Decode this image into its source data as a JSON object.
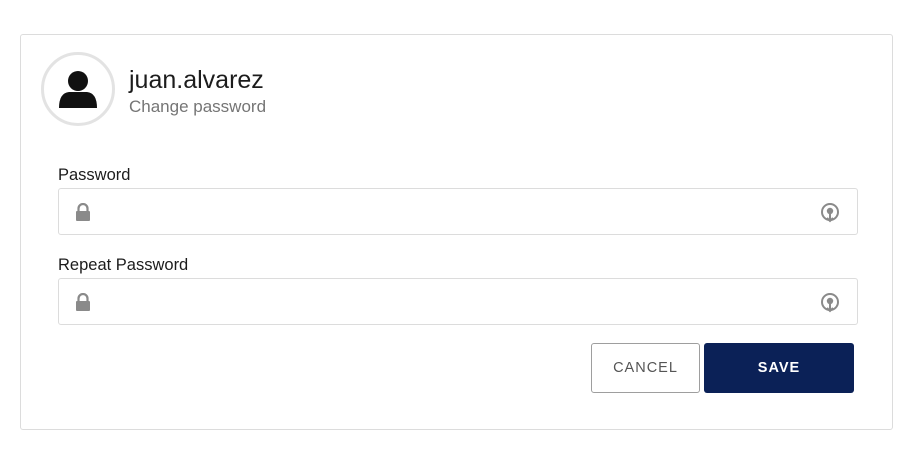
{
  "profile": {
    "username": "juan.alvarez",
    "subtitle": "Change password"
  },
  "form": {
    "password_label": "Password",
    "password_value": "",
    "repeat_label": "Repeat Password",
    "repeat_value": ""
  },
  "actions": {
    "cancel_label": "CANCEL",
    "save_label": "SAVE"
  },
  "icons": {
    "avatar": "user-icon",
    "field_prefix": "lock-icon",
    "field_suffix": "reveal-password-icon"
  },
  "colors": {
    "primary": "#0b2157",
    "primary_text": "#ffffff",
    "border": "#dcdcdc",
    "icon": "#8a8a8a"
  }
}
